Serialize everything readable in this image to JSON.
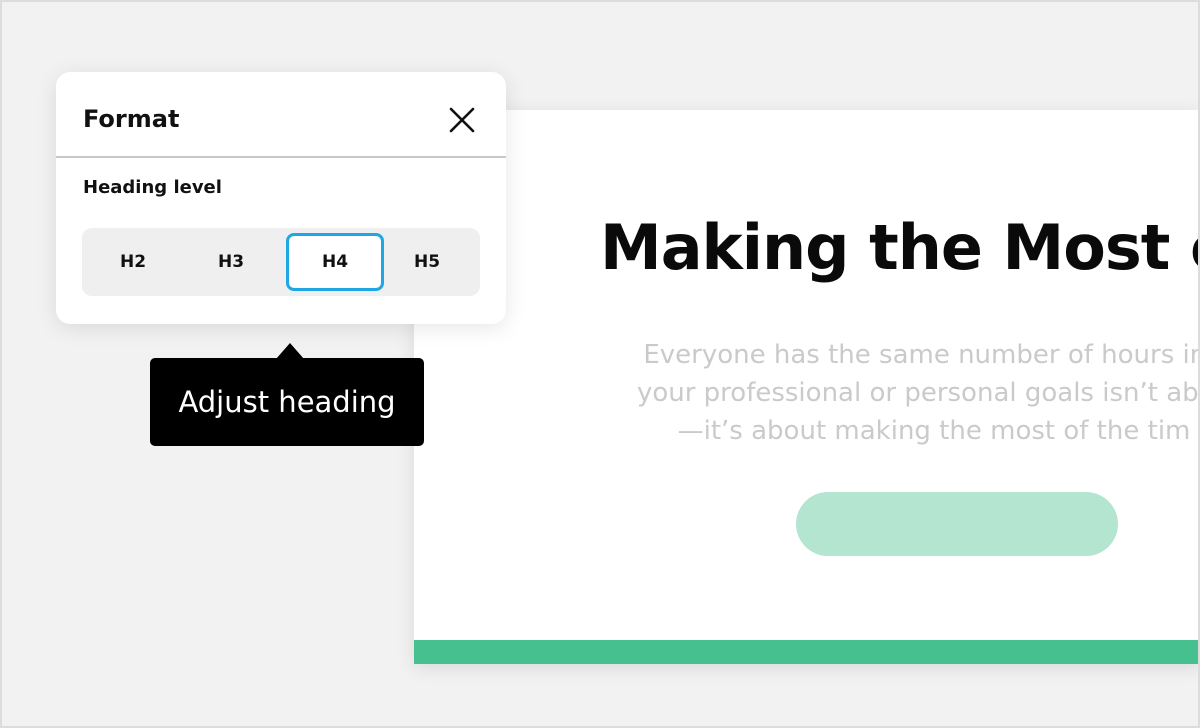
{
  "format_panel": {
    "title": "Format",
    "close_icon": "close-icon",
    "heading_level_label": "Heading level",
    "heading_options": [
      "H2",
      "H3",
      "H4",
      "H5"
    ],
    "selected_option": "H4"
  },
  "tooltip": {
    "text": "Adjust heading"
  },
  "preview": {
    "title": "Making the Most o",
    "body_lines": [
      "Everyone has the same number of hours in t",
      "your professional or personal goals isn’t abou",
      "—it’s about making the most of the tim"
    ],
    "button_color": "#b4e5d1",
    "accent_color": "#47c090"
  },
  "colors": {
    "selection_border": "#1ea7e4",
    "background": "#f2f2f2"
  }
}
